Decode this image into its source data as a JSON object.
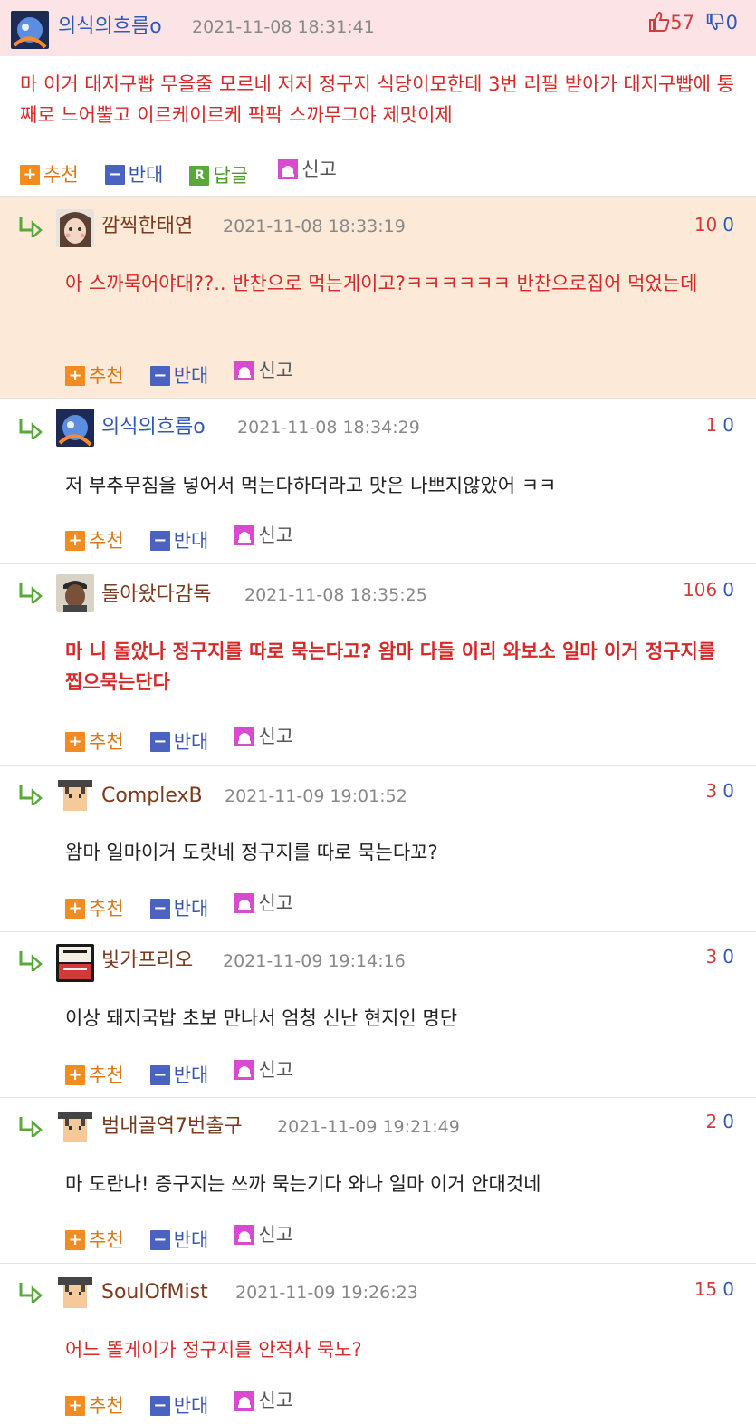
{
  "post": {
    "nickname": "의식의흐름o",
    "date": "2021-11-08 18:31:41",
    "up": "57",
    "down": "0",
    "body": "마 이거 대지구빱 무을줄 모르네 저저 정구지 식당이모한테 3번 리필 받아가 대지구빱에 통째로 느어뿔고 이르케이르케 팍팍 스까무그야 제맛이제",
    "recommend": "추천",
    "oppose": "반대",
    "reply": "답글",
    "report": "신고"
  },
  "actions": {
    "recommend": "추천",
    "oppose": "반대",
    "report": "신고"
  },
  "comments": [
    {
      "nickname": "깜찍한태연",
      "date": "2021-11-08 18:33:19",
      "up": "10",
      "down": "0",
      "body": "아 스까묵어야대??.. 반찬으로 먹는게이고?ㅋㅋㅋㅋㅋㅋ 반찬으로집어 먹었는데"
    },
    {
      "nickname": "의식의흐름o",
      "date": "2021-11-08 18:34:29",
      "up": "1",
      "down": "0",
      "body": "저 부추무침을 넣어서 먹는다하더라고 맛은 나쁘지않았어 ㅋㅋ"
    },
    {
      "nickname": "돌아왔다감독",
      "date": "2021-11-08 18:35:25",
      "up": "106",
      "down": "0",
      "body": "마 니 돌았나 정구지를 따로 묵는다고? 왐마 다들 이리 와보소 일마 이거 정구지를 찝으묵는단다"
    },
    {
      "nickname": "ComplexB",
      "date": "2021-11-09 19:01:52",
      "up": "3",
      "down": "0",
      "body": "왐마 일마이거 도랏네 정구지를 따로 묵는다꼬?"
    },
    {
      "nickname": "빛가프리오",
      "date": "2021-11-09 19:14:16",
      "up": "3",
      "down": "0",
      "body": "이상 돼지국밥 초보 만나서 엄청 신난 현지인 명단"
    },
    {
      "nickname": "범내골역7번출구",
      "date": "2021-11-09 19:21:49",
      "up": "2",
      "down": "0",
      "body": "마 도란나! 증구지는 쓰까 묵는기다 와나 일마 이거 안대것네"
    },
    {
      "nickname": "SoulOfMist",
      "date": "2021-11-09 19:26:23",
      "up": "15",
      "down": "0",
      "body": "어느 똘게이가 정구지를 안적사 묵노?"
    }
  ],
  "colors": {
    "post_header_bg": "#fbe3e6",
    "highlight_bg": "#fde9d7",
    "red_text": "#d42a2a",
    "blue_nick": "#2f5bb8",
    "brown_nick": "#7a3b1f",
    "recommend_orange": "#f08c20",
    "oppose_blue": "#4a62c0",
    "reply_green": "#58a83a",
    "report_magenta": "#d84ad0"
  },
  "icons": {
    "thumbs_up": "thumbs-up-icon",
    "thumbs_down": "thumbs-down-icon",
    "reply_arrow": "reply-arrow-icon",
    "plus": "plus-icon",
    "minus": "minus-icon",
    "reply_r": "reply-r-icon",
    "siren": "siren-icon"
  }
}
